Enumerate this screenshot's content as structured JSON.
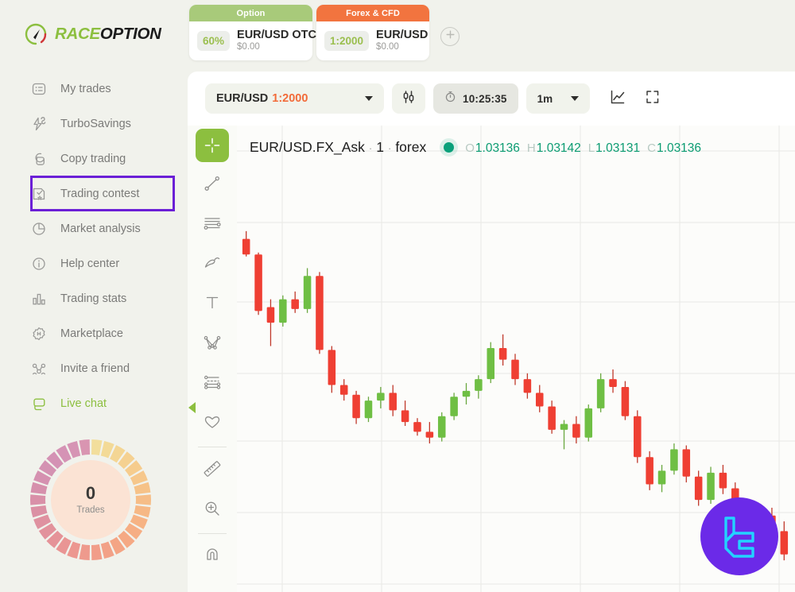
{
  "brand": {
    "part1": "RACE",
    "part2": "OPTION",
    "logo_icon": "raceoption-speedometer-logo"
  },
  "sidebar": {
    "items": [
      {
        "label": "My trades",
        "icon": "list-card-icon"
      },
      {
        "label": "TurboSavings",
        "icon": "lightning-savings-icon"
      },
      {
        "label": "Copy trading",
        "icon": "copy-documents-icon"
      },
      {
        "label": "Trading contest",
        "icon": "trophy-star-icon",
        "highlighted": true
      },
      {
        "label": "Market analysis",
        "icon": "pie-chart-icon"
      },
      {
        "label": "Help center",
        "icon": "info-circle-icon"
      },
      {
        "label": "Trading stats",
        "icon": "bar-chart-icon"
      },
      {
        "label": "Marketplace",
        "icon": "store-badge-icon"
      },
      {
        "label": "Invite a friend",
        "icon": "people-network-icon"
      },
      {
        "label": "Live chat",
        "icon": "chat-bubbles-icon"
      }
    ],
    "highlight_color": "#6b1fd6",
    "active_color": "#8cbf3f",
    "trades_widget": {
      "count": "0",
      "label": "Trades"
    }
  },
  "top_tabs": {
    "tabs": [
      {
        "caption": "Option",
        "caption_color": "#a8ca7a",
        "badge": "60%",
        "instrument": "EUR/USD OTC",
        "amount": "$0.00"
      },
      {
        "caption": "Forex & CFD",
        "caption_color": "#f2743f",
        "badge": "1:2000",
        "instrument": "EUR/USD",
        "amount": "$0.00"
      }
    ],
    "add_tab_icon": "plus-circle-icon"
  },
  "toolbar": {
    "symbol": "EUR/USD",
    "leverage": "1:2000",
    "symbol_caret_icon": "chevron-down-icon",
    "candles_icon": "candlestick-icon",
    "clock_icon": "stopwatch-icon",
    "server_time": "10:25:35",
    "timeframe": "1m",
    "timeframe_caret_icon": "chevron-down-icon",
    "chart_type_icon": "line-chart-icon",
    "fullscreen_icon": "expand-fullscreen-icon"
  },
  "draw_tools": [
    {
      "icon": "crosshair-cursor-icon",
      "active": true
    },
    {
      "icon": "trend-line-icon",
      "active": false
    },
    {
      "icon": "horizontal-lines-icon",
      "active": false
    },
    {
      "icon": "brush-draw-icon",
      "active": false
    },
    {
      "icon": "text-tool-icon",
      "active": false
    },
    {
      "icon": "pattern-shapes-icon",
      "active": false
    },
    {
      "icon": "fib-levels-icon",
      "active": false
    },
    {
      "icon": "favorites-heart-icon",
      "active": false
    },
    {
      "icon": "ruler-measure-icon",
      "active": false
    },
    {
      "icon": "zoom-in-icon",
      "active": false
    },
    {
      "icon": "magnet-icon",
      "active": false
    }
  ],
  "chart_header": {
    "symbol": "EUR/USD.FX_Ask",
    "interval": "1",
    "market": "forex",
    "status_icon": "connected-dot-icon",
    "ohlc": [
      {
        "label": "O",
        "value": "1.03136"
      },
      {
        "label": "H",
        "value": "1.03142"
      },
      {
        "label": "L",
        "value": "1.03131"
      },
      {
        "label": "C",
        "value": "1.03136"
      }
    ],
    "value_color": "#0c9c72"
  },
  "collapse_handle_icon": "collapse-left-arrow-icon",
  "watermark": {
    "icon": "lc-monogram-logo",
    "bg": "#6b2ae8",
    "stroke": "#22d3ff"
  },
  "chart_data": {
    "type": "candlestick",
    "title": "EUR/USD.FX_Ask · 1 · forex",
    "interval": "1m",
    "up_color": "#6fbf44",
    "down_color": "#ef3f33",
    "grid": true,
    "ylim": [
      1.0309,
      1.0323
    ],
    "xlabel": "",
    "ylabel": "",
    "candles": [
      {
        "o": 1.03215,
        "h": 1.03219,
        "l": 1.03206,
        "c": 1.03207
      },
      {
        "o": 1.03207,
        "h": 1.03208,
        "l": 1.03176,
        "c": 1.03178
      },
      {
        "o": 1.0318,
        "h": 1.03184,
        "l": 1.0316,
        "c": 1.03172
      },
      {
        "o": 1.03172,
        "h": 1.03186,
        "l": 1.0317,
        "c": 1.03184
      },
      {
        "o": 1.03184,
        "h": 1.03188,
        "l": 1.03177,
        "c": 1.03179
      },
      {
        "o": 1.03179,
        "h": 1.032,
        "l": 1.03177,
        "c": 1.03196
      },
      {
        "o": 1.03196,
        "h": 1.03198,
        "l": 1.03156,
        "c": 1.03158
      },
      {
        "o": 1.03158,
        "h": 1.0316,
        "l": 1.03136,
        "c": 1.0314
      },
      {
        "o": 1.0314,
        "h": 1.03143,
        "l": 1.03132,
        "c": 1.03135
      },
      {
        "o": 1.03135,
        "h": 1.03137,
        "l": 1.0312,
        "c": 1.03123
      },
      {
        "o": 1.03123,
        "h": 1.03134,
        "l": 1.03121,
        "c": 1.03132
      },
      {
        "o": 1.03132,
        "h": 1.03139,
        "l": 1.03128,
        "c": 1.03136
      },
      {
        "o": 1.03136,
        "h": 1.0314,
        "l": 1.03124,
        "c": 1.03127
      },
      {
        "o": 1.03127,
        "h": 1.03132,
        "l": 1.03119,
        "c": 1.03121
      },
      {
        "o": 1.03121,
        "h": 1.03123,
        "l": 1.03114,
        "c": 1.03116
      },
      {
        "o": 1.03116,
        "h": 1.03121,
        "l": 1.0311,
        "c": 1.03113
      },
      {
        "o": 1.03113,
        "h": 1.03126,
        "l": 1.03111,
        "c": 1.03124
      },
      {
        "o": 1.03124,
        "h": 1.03136,
        "l": 1.03122,
        "c": 1.03134
      },
      {
        "o": 1.03134,
        "h": 1.03141,
        "l": 1.0313,
        "c": 1.03137
      },
      {
        "o": 1.03137,
        "h": 1.03145,
        "l": 1.03133,
        "c": 1.03143
      },
      {
        "o": 1.03143,
        "h": 1.03162,
        "l": 1.03141,
        "c": 1.03159
      },
      {
        "o": 1.03159,
        "h": 1.03166,
        "l": 1.0315,
        "c": 1.03153
      },
      {
        "o": 1.03153,
        "h": 1.03156,
        "l": 1.0314,
        "c": 1.03143
      },
      {
        "o": 1.03143,
        "h": 1.03146,
        "l": 1.03133,
        "c": 1.03136
      },
      {
        "o": 1.03136,
        "h": 1.0314,
        "l": 1.03126,
        "c": 1.03129
      },
      {
        "o": 1.03129,
        "h": 1.03132,
        "l": 1.03115,
        "c": 1.03117
      },
      {
        "o": 1.03117,
        "h": 1.03122,
        "l": 1.03107,
        "c": 1.0312
      },
      {
        "o": 1.0312,
        "h": 1.03124,
        "l": 1.0311,
        "c": 1.03113
      },
      {
        "o": 1.03113,
        "h": 1.0313,
        "l": 1.03111,
        "c": 1.03128
      },
      {
        "o": 1.03128,
        "h": 1.03146,
        "l": 1.03126,
        "c": 1.03143
      },
      {
        "o": 1.03143,
        "h": 1.03148,
        "l": 1.03136,
        "c": 1.03139
      },
      {
        "o": 1.03139,
        "h": 1.03142,
        "l": 1.03122,
        "c": 1.03124
      },
      {
        "o": 1.03124,
        "h": 1.03127,
        "l": 1.031,
        "c": 1.03103
      },
      {
        "o": 1.03103,
        "h": 1.03106,
        "l": 1.03086,
        "c": 1.03089
      },
      {
        "o": 1.03089,
        "h": 1.03099,
        "l": 1.03085,
        "c": 1.03096
      },
      {
        "o": 1.03096,
        "h": 1.0311,
        "l": 1.03094,
        "c": 1.03107
      },
      {
        "o": 1.03107,
        "h": 1.03109,
        "l": 1.0309,
        "c": 1.03093
      },
      {
        "o": 1.03093,
        "h": 1.03096,
        "l": 1.03078,
        "c": 1.03081
      },
      {
        "o": 1.03081,
        "h": 1.03098,
        "l": 1.03079,
        "c": 1.03095
      },
      {
        "o": 1.03095,
        "h": 1.03099,
        "l": 1.03084,
        "c": 1.03087
      },
      {
        "o": 1.03087,
        "h": 1.0309,
        "l": 1.03068,
        "c": 1.0307
      },
      {
        "o": 1.0307,
        "h": 1.03074,
        "l": 1.03055,
        "c": 1.03058
      },
      {
        "o": 1.03058,
        "h": 1.03076,
        "l": 1.03056,
        "c": 1.03073
      },
      {
        "o": 1.03073,
        "h": 1.03077,
        "l": 1.03062,
        "c": 1.03065
      },
      {
        "o": 1.03065,
        "h": 1.0307,
        "l": 1.0305,
        "c": 1.03053
      }
    ]
  }
}
